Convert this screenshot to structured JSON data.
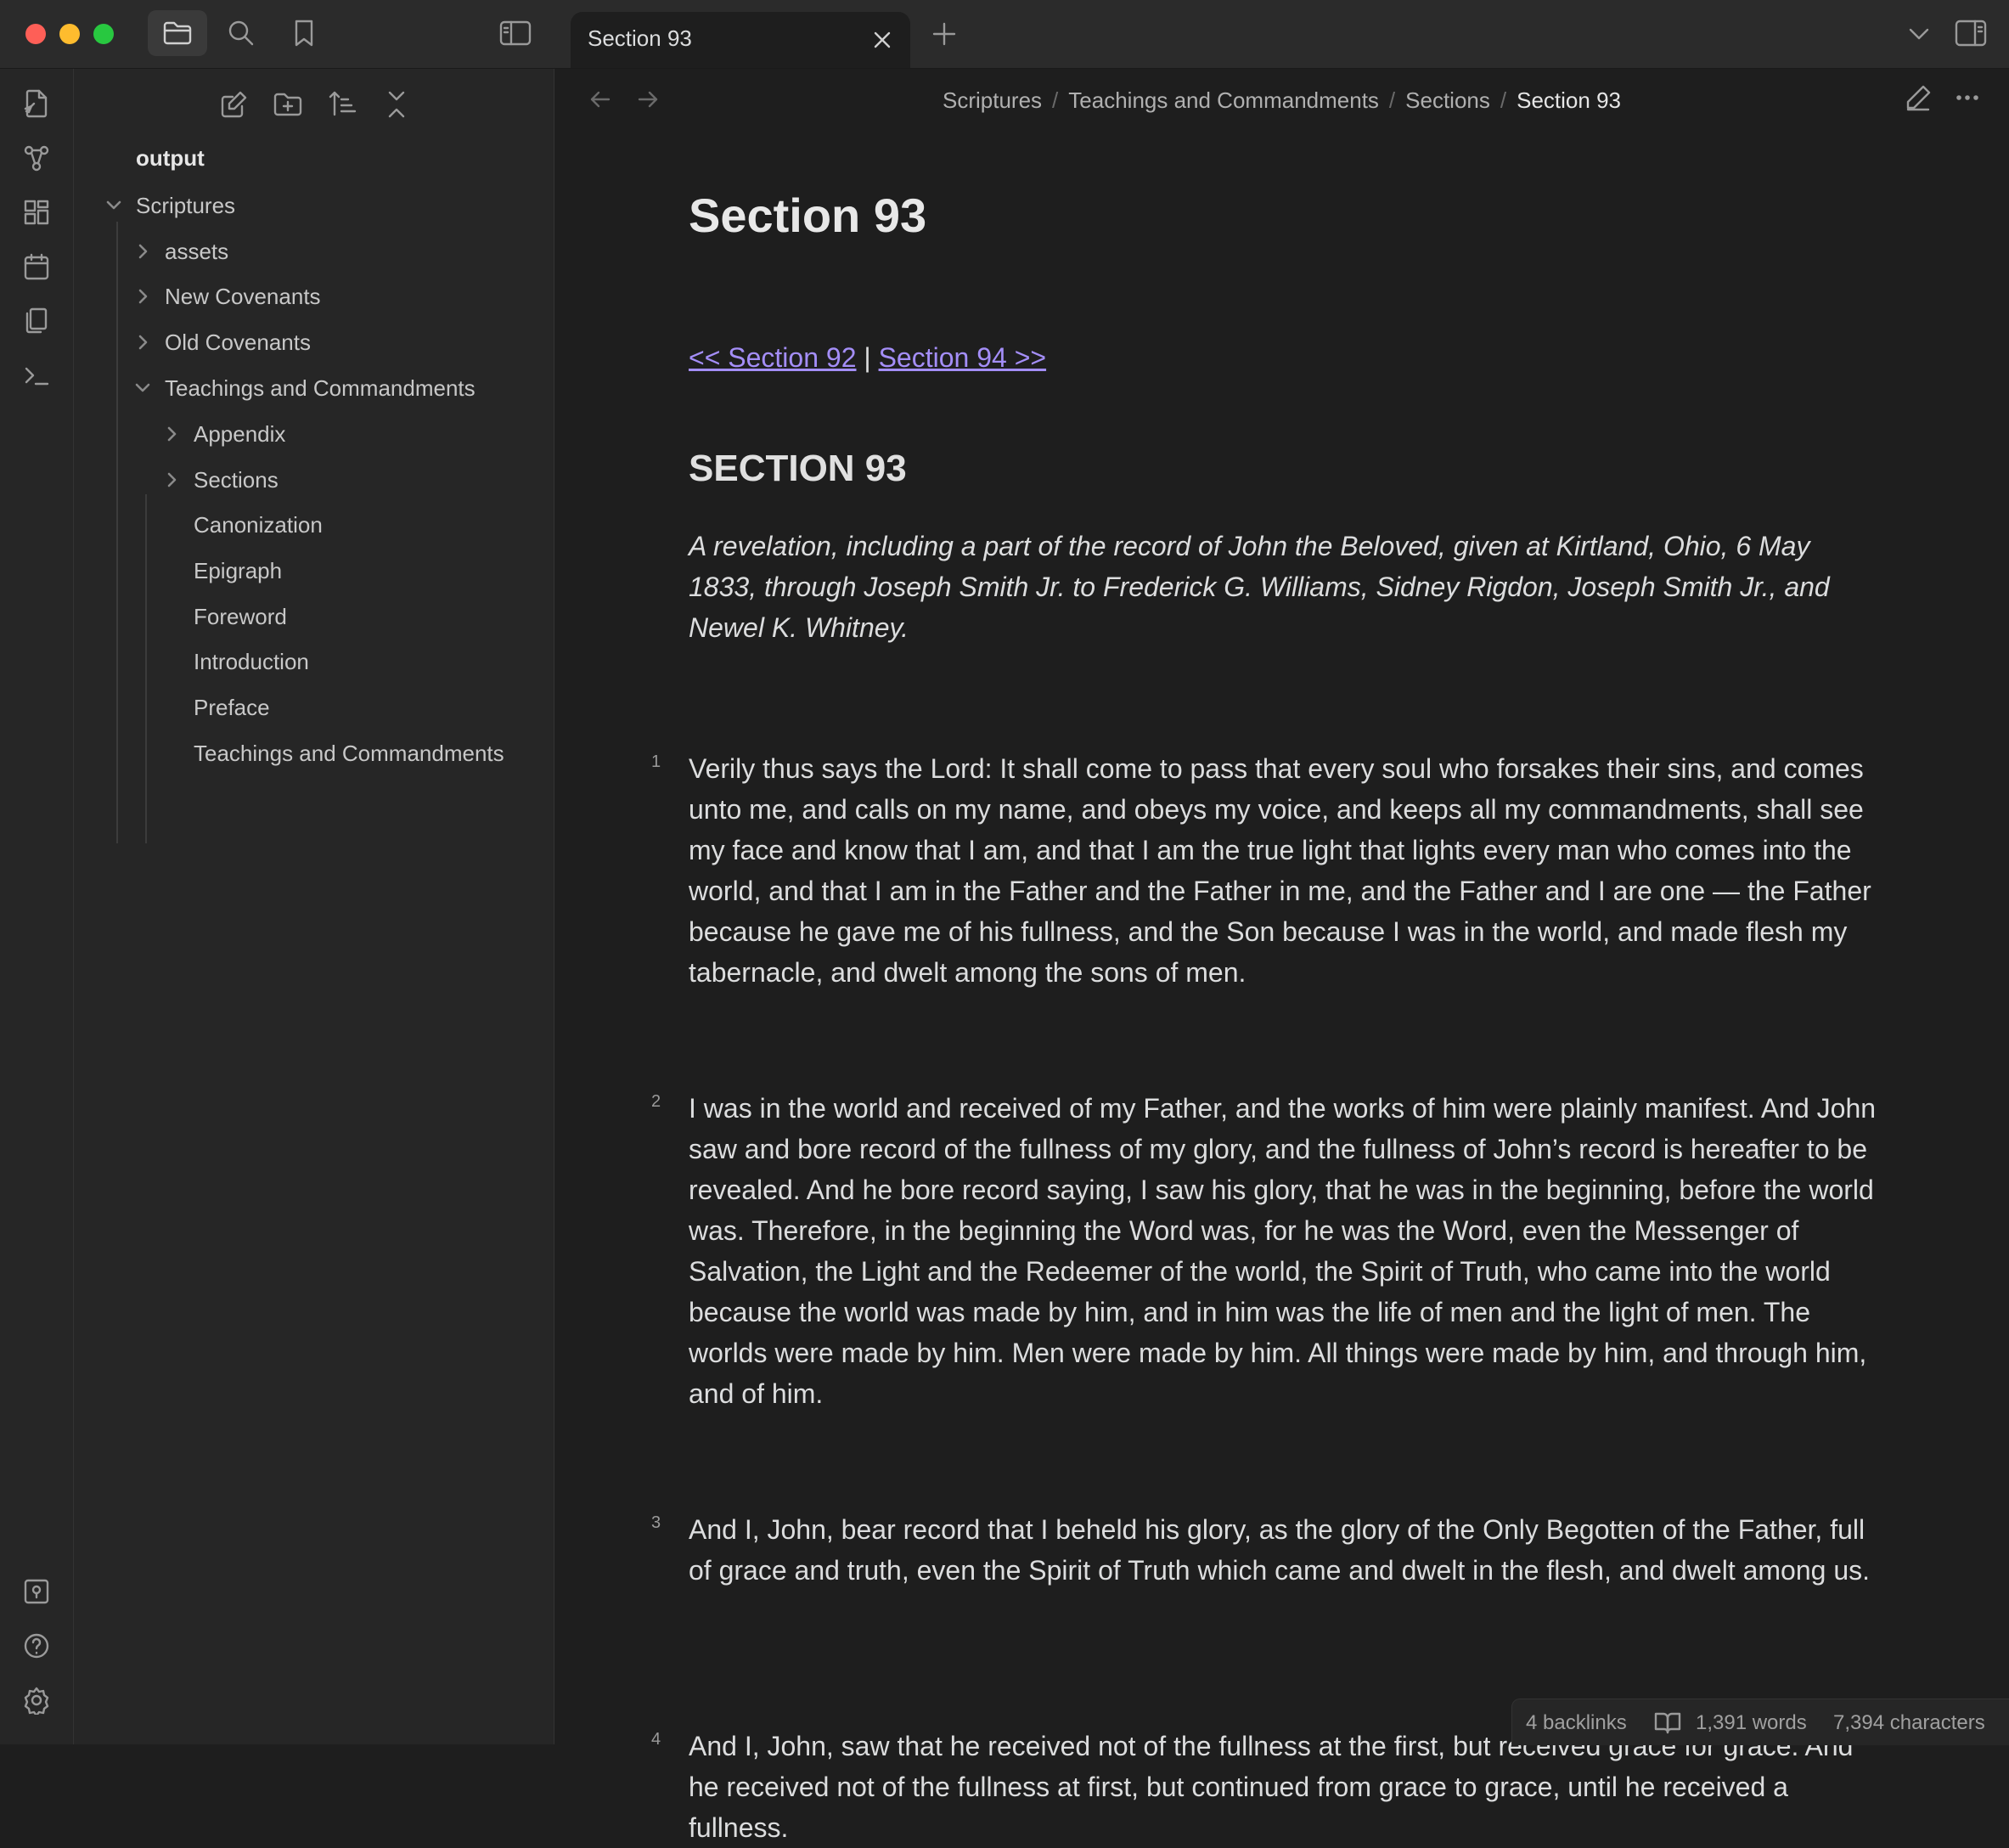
{
  "window": {
    "tab_title": "Section 93",
    "icons": [
      "folder-icon",
      "search-icon",
      "bookmark-icon",
      "sidebar-toggle-icon",
      "close-icon",
      "plus-icon",
      "chevron-down-icon",
      "right-sidebar-icon"
    ]
  },
  "ribbon": {
    "items": [
      "open-quick-switcher-icon",
      "graph-view-icon",
      "canvas-icon",
      "daily-note-icon",
      "templates-icon",
      "terminal-icon"
    ],
    "bottom": [
      "vault-switcher-icon",
      "help-icon",
      "settings-icon"
    ]
  },
  "sidebar": {
    "actions": [
      "new-note-icon",
      "new-folder-icon",
      "sort-icon",
      "collapse-all-icon"
    ],
    "vault_name": "output",
    "tree": {
      "scriptures": "Scriptures",
      "assets": "assets",
      "new_covenants": "New Covenants",
      "old_covenants": "Old Covenants",
      "teachings": "Teachings and Commandments",
      "appendix": "Appendix",
      "sections": "Sections",
      "canonization": "Canonization",
      "epigraph": "Epigraph",
      "foreword": "Foreword",
      "introduction": "Introduction",
      "preface": "Preface",
      "teachings_note": "Teachings and Commandments"
    }
  },
  "breadcrumb": {
    "items": [
      "Scriptures",
      "Teachings and Commandments",
      "Sections",
      "Section 93"
    ],
    "separator": "/"
  },
  "document": {
    "title": "Section 93",
    "prev_link": "<< Section 92",
    "divider": "|",
    "next_link": "Section 94 >>",
    "section_heading": "SECTION 93",
    "summary": "A revelation, including a part of the record of John the Beloved, given at Kirtland, Ohio, 6 May 1833, through Joseph Smith Jr. to Frederick G. Williams, Sidney Rigdon, Joseph Smith Jr., and Newel K. Whitney.",
    "verses": [
      {
        "num": "1",
        "text": "Verily thus says the Lord: It shall come to pass that every soul who forsakes their sins, and comes unto me, and calls on my name, and obeys my voice, and keeps all my commandments, shall see my face and know that I am, and that I am the true light that lights every man who comes into the world, and that I am in the Father and the Father in me, and the Father and I are one — the Father because he gave me of his fullness, and the Son because I was in the world, and made flesh my tabernacle, and dwelt among the sons of men."
      },
      {
        "num": "2",
        "text": "I was in the world and received of my Father, and the works of him were plainly manifest. And John saw and bore record of the fullness of my glory, and the fullness of John’s record is hereafter to be revealed. And he bore record saying, I saw his glory, that he was in the beginning, before the world was. Therefore, in the beginning the Word was, for he was the Word, even the Messenger of Salvation, the Light and the Redeemer of the world, the Spirit of Truth, who came into the world because the world was made by him, and in him was the life of men and the light of men. The worlds were made by him. Men were made by him. All things were made by him, and through him, and of him."
      },
      {
        "num": "3",
        "text": "And I, John, bear record that I beheld his glory, as the glory of the Only Begotten of the Father, full of grace and truth, even the Spirit of Truth which came and dwelt in the flesh, and dwelt among us."
      },
      {
        "num": "4",
        "text": "And I, John, saw that he received not of the fullness at the first, but received grace for grace. And he received not of the fullness at first, but continued from grace to grace, until he received a fullness."
      }
    ]
  },
  "status": {
    "backlinks": "4 backlinks",
    "words": "1,391 words",
    "characters": "7,394 characters"
  }
}
